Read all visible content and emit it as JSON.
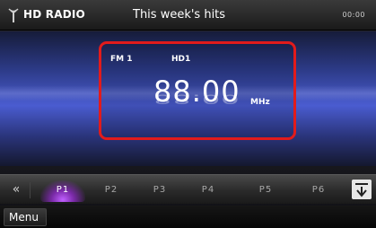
{
  "header": {
    "source": "HD RADIO",
    "title": "This week's hits",
    "clock": "00:00"
  },
  "tuner": {
    "band": "FM 1",
    "hd_channel": "HD1",
    "frequency": "88.00",
    "unit": "MHz"
  },
  "presets": {
    "items": [
      "P1",
      "P2",
      "P3",
      "P4",
      "P5",
      "P6"
    ],
    "selected": "P1",
    "prev_glyph": "«"
  },
  "menu": {
    "label": "Menu"
  },
  "colors": {
    "highlight_border": "#e21b1b",
    "active_preset_glow": "#c060ff",
    "display_blue": "#4a5cd0"
  }
}
